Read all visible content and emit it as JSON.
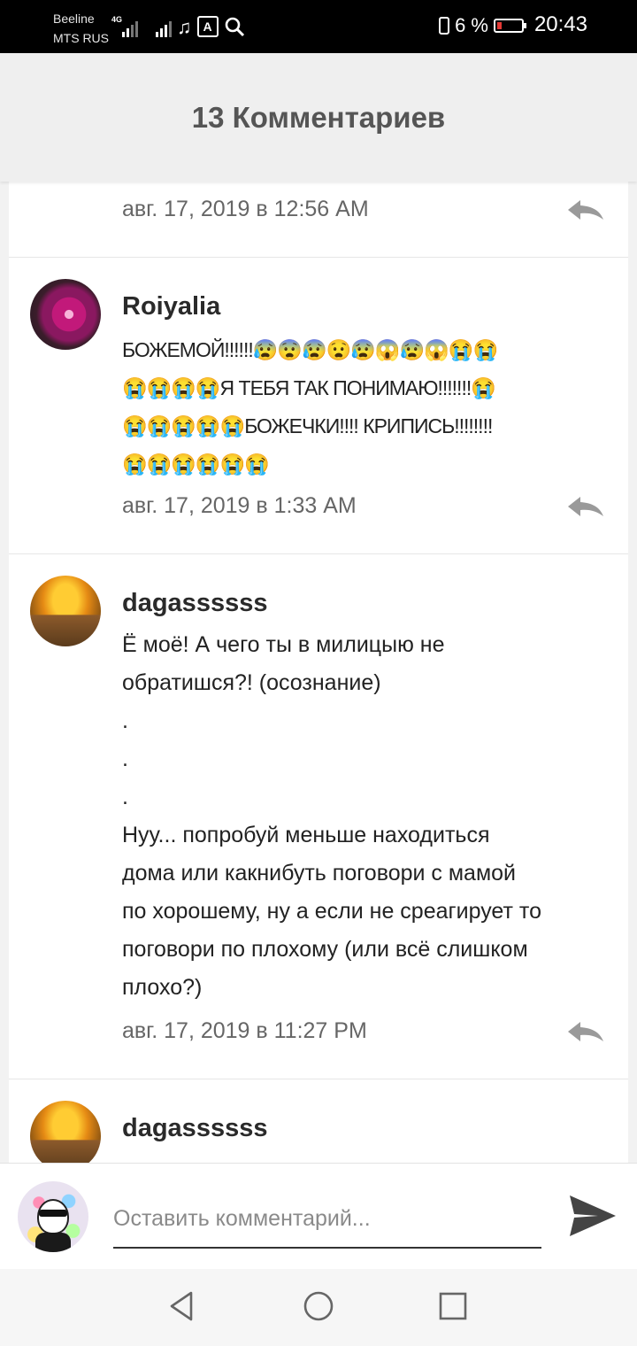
{
  "status_bar": {
    "carrier1": "Beeline",
    "carrier2": "MTS RUS",
    "network": "4G",
    "battery": "6 %",
    "time": "20:43"
  },
  "header": {
    "title": "13 Комментариев"
  },
  "comments": [
    {
      "date": "авг. 17, 2019 в 12:56 AM"
    },
    {
      "user": "Roiyalia",
      "lines": [
        "БОЖЕМОЙ!!!!!!😰😨😰😧😰😱😰😱😭😭",
        "😭😭😭😭Я ТЕБЯ ТАК ПОНИМАЮ!!!!!!!😭",
        "😭😭😭😭😭БОЖЕЧКИ!!!! КРИПИСЬ!!!!!!!!",
        "😭😭😭😭😭😭"
      ],
      "date": "авг. 17, 2019 в 1:33 AM"
    },
    {
      "user": "dagassssss",
      "lines": [
        "Ё моё! А чего ты в милицыю не",
        "обратишся?! (осознание)",
        ".",
        ".",
        ".",
        "Нуу... попробуй меньше находиться",
        "дома или какнибуть поговори с мамой",
        "по хорошему, ну а если не среагирует то",
        "поговори по плохому (или всё слишком",
        "плохо?)"
      ],
      "date": "авг. 17, 2019 в 11:27 PM"
    },
    {
      "user": "dagassssss"
    }
  ],
  "comment_input": {
    "placeholder": "Оставить комментарий..."
  },
  "icons": {
    "reply": "reply-arrow-icon",
    "send": "send-icon",
    "nav": [
      "back-triangle-icon",
      "home-circle-icon",
      "recents-square-icon"
    ]
  },
  "colors": {
    "battery_low": "#e53935",
    "header_bg": "#efefef",
    "statusbar_bg": "#000000"
  }
}
